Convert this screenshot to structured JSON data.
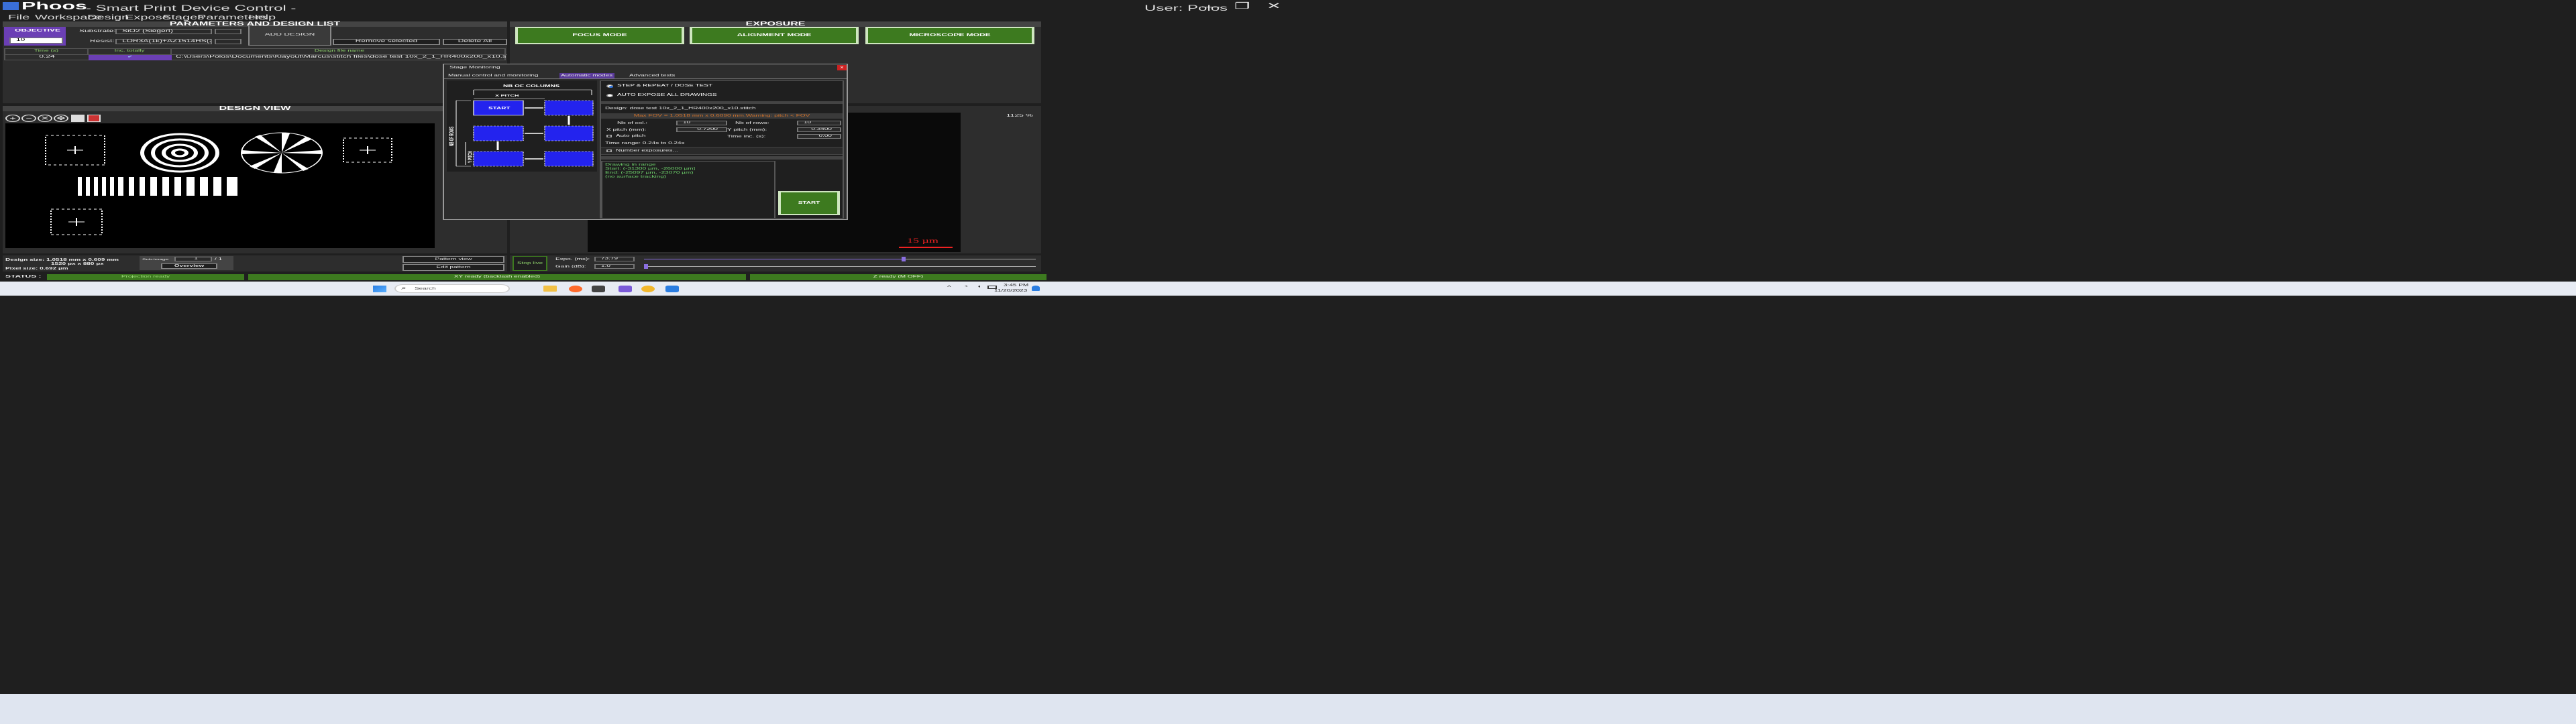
{
  "window": {
    "app_name": "Phoos",
    "title_suffix": " - Smart Print Device Control -",
    "user": "User: Polos",
    "controls": {
      "minimize": "—",
      "maximize": "❐",
      "close": "✕"
    }
  },
  "menu": [
    "File",
    "Workspace",
    "Design",
    "Expose",
    "Stages",
    "Parameters",
    "Help"
  ],
  "params": {
    "header": "PARAMETERS AND DESIGN LIST",
    "objective_label": "OBJECTIVE",
    "objective_value": "10",
    "substrate_label": "Substrate:",
    "substrate_value": "SiO2 (Siegert)",
    "resist_label": "Resist:",
    "resist_value": "LOR3A(1k)+AZ1514HS(2k)",
    "add_design": "ADD DESIGN",
    "remove_selected": "Remove selected",
    "delete_all": "Delete All",
    "table_headers": [
      "Time (s)",
      "Inc. totally",
      "Design file name"
    ],
    "table_rows": [
      {
        "time": "0.24",
        "inc": "✔",
        "file": "C:\\Users\\Polos\\Documents\\Klayout\\Marcus\\stitch files\\dose test 10x_2_1_HR400x200_x10.stitch"
      }
    ]
  },
  "design_view": {
    "header": "DESIGN VIEW",
    "tool_icons": [
      "zoom-in-icon",
      "zoom-out-icon",
      "fit-icon",
      "pan-icon",
      "save-icon",
      "image-icon"
    ],
    "info_size": "Design size: 1.0518 mm x 0.609 mm",
    "info_px": "1520 px x 880 px",
    "info_pixel": "Pixel size: 0.692 µm",
    "subimage_label": "Sub-image:",
    "subimage_value": "1",
    "subimage_total": "/ 1",
    "overview": "Overview",
    "pattern_view": "Pattern view",
    "edit_pattern": "Edit pattern"
  },
  "exposure": {
    "header": "EXPOSURE",
    "focus_mode": "FOCUS MODE",
    "alignment_mode": "ALIGNMENT MODE",
    "microscope_mode": "MICROSCOPE MODE",
    "zoom": "1125 %",
    "scale_bar": "15 µm",
    "stop_live": "Stop live",
    "expo_label": "Expo. (ms):",
    "expo_value": "73.79",
    "expo_level": 0.66,
    "gain_label": "Gain (dB):",
    "gain_value": "1.0",
    "gain_level": 0.0
  },
  "status": {
    "label": "STATUS :",
    "projection": "Projection ready",
    "xy": "XY ready (backlash enabled)",
    "z": "Z ready (M OFF)"
  },
  "dialog": {
    "title": "Stage Monitoring",
    "close": "x",
    "tabs": [
      "Manual control and monitoring",
      "Automatic modes",
      "Advanced tests"
    ],
    "active_tab": 1,
    "diagram": {
      "nb_columns": "NB OF COLUMNS",
      "x_pitch": "X PITCH",
      "nb_rows": "NB OF ROWS",
      "y_pitch": "Y PITCH",
      "start": "START"
    },
    "mode_step": "STEP & REPEAT / DOSE TEST",
    "mode_auto": "AUTO EXPOSE ALL DRAWINGS",
    "design_line": "Design: dose test 10x_2_1_HR400x200_x10.stitch",
    "warning": "Max FOV = 1.0518 mm x 0.6090 mm.Warning: pitch < FOV",
    "nb_col_label": "Nb of col.:",
    "nb_col_value": "10",
    "nb_rows_label": "Nb of rows:",
    "nb_rows_value": "10",
    "x_pitch_label": "X pitch (mm):",
    "x_pitch_value": "0.7200",
    "y_pitch_label": "Y pitch (mm):",
    "y_pitch_value": "0.3400",
    "auto_pitch_label": "Auto pitch",
    "time_inc_label": "Time inc. (s):",
    "time_inc_value": "0.00",
    "time_range": "Time range: 0.24s to 0.24s",
    "number_exposures": "Number exposures...",
    "log": [
      "Drawing in range",
      "Start: (-31300 µm, -26000 µm)",
      "End: (-25097 µm, -23070 µm)",
      "(no surface tracking)"
    ],
    "start_button": "START"
  },
  "taskbar": {
    "search": "Search",
    "time": "3:45 PM",
    "date": "11/20/2023"
  }
}
